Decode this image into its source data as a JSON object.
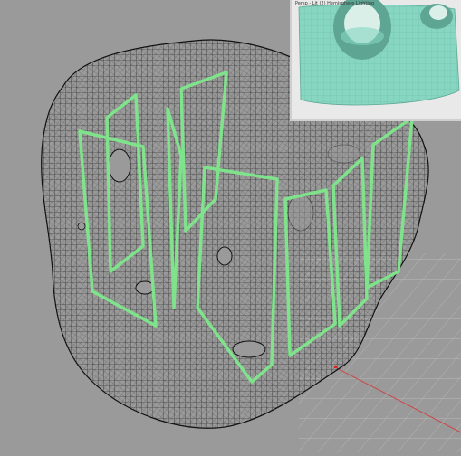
{
  "viewport": {
    "main_view": "wireframe subdivision mesh",
    "cage_color": "#7ee38a",
    "mesh_color": "#111111",
    "background": "#9a9a9a",
    "grid_color": "#bdbdbd",
    "axis_x_color": "#d23a3a"
  },
  "inset": {
    "title": "Persp - Lit (2) Hemisphere Lighting",
    "surface_color": "#86d6c1"
  }
}
